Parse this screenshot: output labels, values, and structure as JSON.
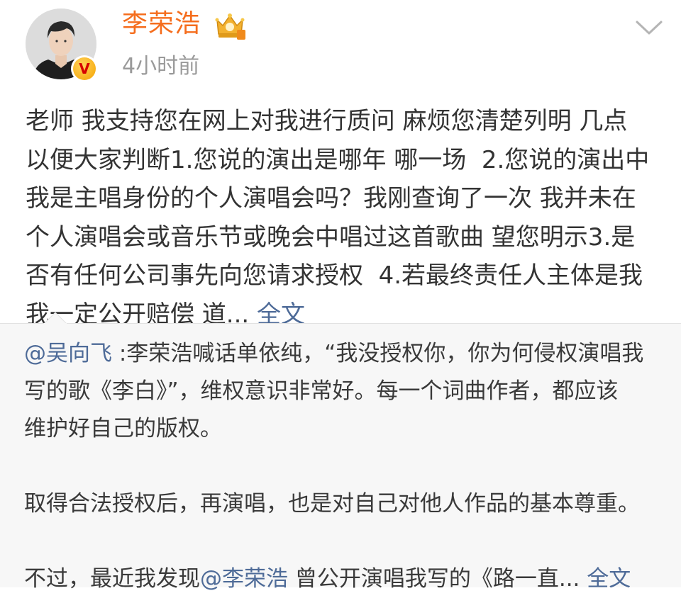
{
  "post": {
    "author": "李荣浩",
    "time": "4小时前",
    "content_lines": [
      "老师 我支持您在网上对我进行质问 麻烦您清楚列明 几点",
      "以便大家判断1.您说的演出是哪年 哪一场  2.您说的演出中",
      "我是主唱身份的个人演唱会吗？我刚查询了一次 我并未在",
      "个人演唱会或音乐节或晚会中唱过这首歌曲 望您明示3.是",
      "否有任何公司事先向您请求授权  4.若最终责任人主体是我"
    ],
    "last_line": "我一定公开赔偿 道... ",
    "fulltext_label": "全文",
    "colors": {
      "author": "#f56d1d",
      "link": "#4e6b98",
      "time": "#9a9a9a"
    },
    "icons": [
      "avatar",
      "verified-v-icon",
      "crown-member-icon",
      "chevron-down-icon"
    ]
  },
  "repost": {
    "mention_author": "@吴向飞",
    "line1_rest": " :李荣浩喊话单依纯，“我没授权你，你为何侵权演唱我",
    "line2": "写的歌《李白》”，维权意识非常好。每一个词曲作者，都应该",
    "line3": "维护好自己的版权。",
    "line4": "取得合法授权后，再演唱，也是对自己对他人作品的基本尊重。",
    "line5_pre": "不过，最近我发现",
    "line5_mention": "@李荣浩",
    "line5_post": " 曾公开演唱我写的《路一直... ",
    "fulltext_label": "全文"
  }
}
